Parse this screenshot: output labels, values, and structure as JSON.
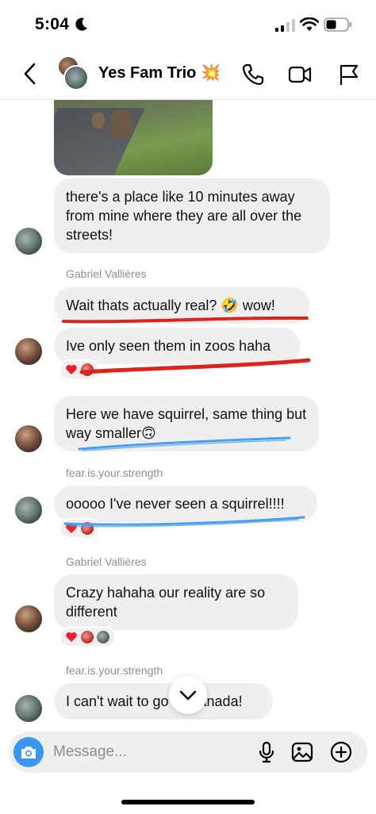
{
  "status_bar": {
    "time": "5:04"
  },
  "header": {
    "title": "Yes Fam Trio 💥"
  },
  "messages": [
    {
      "text": "there's a place like 10 minutes away from mine where they are all over the streets!"
    },
    {
      "sender": "Gabriel Vallières"
    },
    {
      "text": "Wait thats actually real? 🤣 wow!"
    },
    {
      "text": "Ive only seen them in zoos haha"
    },
    {
      "text": "Here we have squirrel, same thing but way smaller🙃"
    },
    {
      "sender": "fear.is.your.strength"
    },
    {
      "text": "ooooo I've never seen a squirrel!!!!"
    },
    {
      "sender": "Gabriel Vallières"
    },
    {
      "text": "Crazy hahaha our reality are so different"
    },
    {
      "sender": "fear.is.your.strength"
    },
    {
      "text": "I can't wait to go to Canada!"
    }
  ],
  "composer": {
    "placeholder": "Message..."
  },
  "colors": {
    "accent": "#3897f0",
    "bubble": "#efefef",
    "scribble_red": "#e0231a",
    "scribble_blue": "#4aa0f0"
  }
}
